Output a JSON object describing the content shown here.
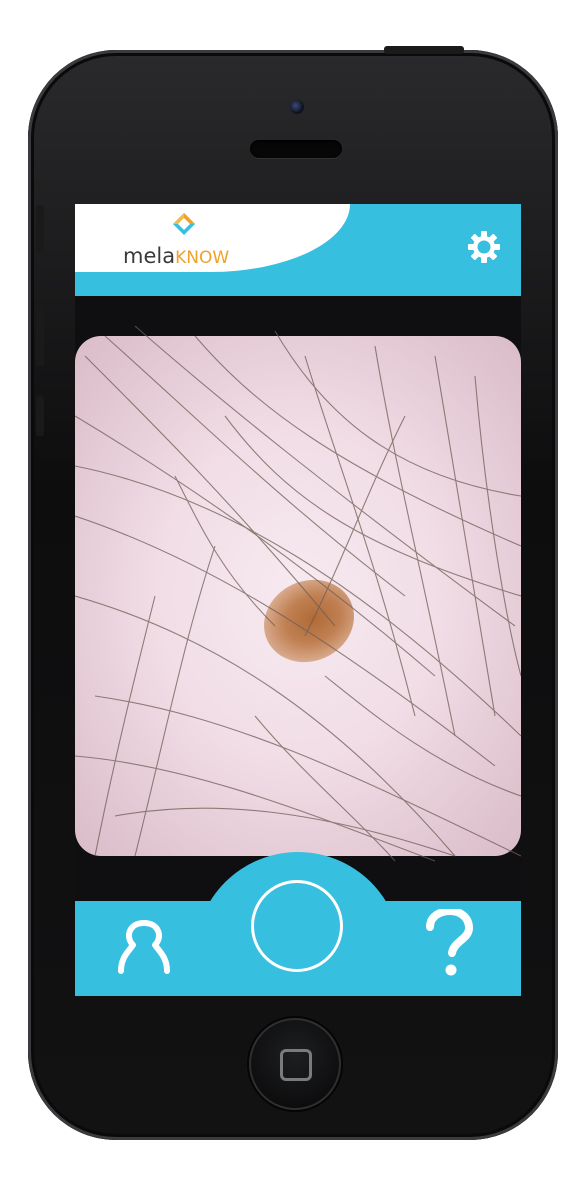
{
  "app": {
    "logo_prefix": "mela",
    "logo_suffix": "KNOW",
    "brand_color": "#37bfe0",
    "logo_accent_color": "#f0a12a"
  },
  "header": {
    "settings_icon": "gear-icon"
  },
  "camera": {
    "preview": "dermoscopy-live-view"
  },
  "bottom_bar": {
    "profile_icon": "person-icon",
    "capture_icon": "shutter-circle-icon",
    "help_icon": "question-mark-icon",
    "help_glyph": "?"
  }
}
